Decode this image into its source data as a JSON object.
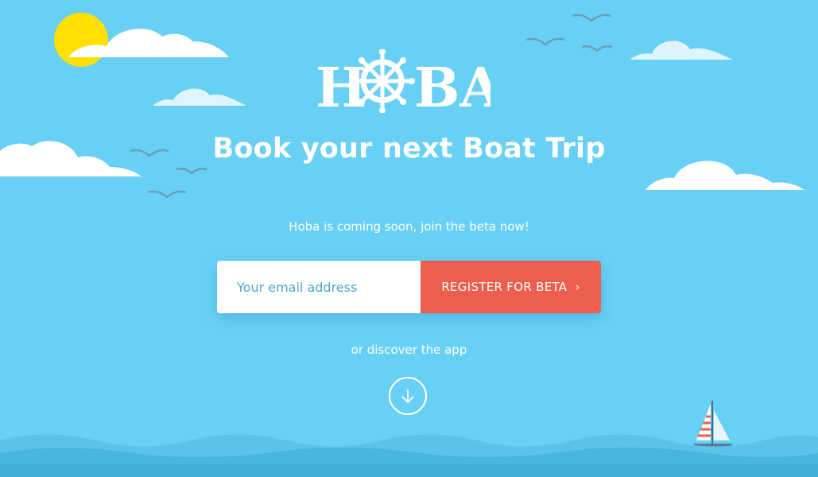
{
  "brand": {
    "logo_text_left": "H",
    "logo_text_right": "BA"
  },
  "hero": {
    "headline": "Book your next Boat Trip",
    "subline": "Hoba is coming soon, join the beta now!"
  },
  "signup": {
    "email_placeholder": "Your email address",
    "register_label": "REGISTER FOR BETA",
    "register_chevron": "›"
  },
  "discover": {
    "label": "or discover the app"
  },
  "colors": {
    "sky": "#67d0f4",
    "sun": "#ffe000",
    "cta": "#ee5e4f",
    "wave_light": "#5cc3e8",
    "wave_dark": "#3fb0dc"
  },
  "icons": {
    "logo_wheel": "ship-wheel-icon",
    "chevron": "chevron-right-icon",
    "scroll_down": "arrow-down-icon",
    "boat": "sailboat-icon"
  }
}
